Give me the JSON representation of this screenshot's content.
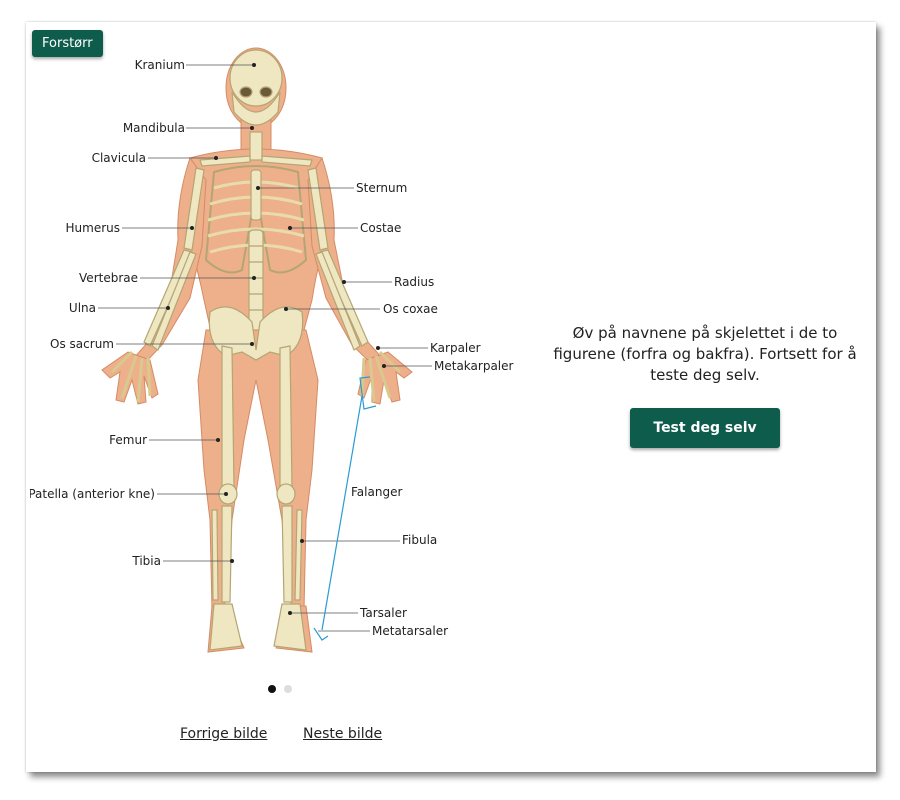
{
  "toolbar": {
    "enlarge_label": "Forstørr"
  },
  "labels": {
    "kranium": "Kranium",
    "mandibula": "Mandibula",
    "clavicula": "Clavicula",
    "humerus": "Humerus",
    "vertebrae": "Vertebrae",
    "ulna": "Ulna",
    "os_sacrum": "Os sacrum",
    "femur": "Femur",
    "patella": "Patella (anterior kne)",
    "tibia": "Tibia",
    "sternum": "Sternum",
    "costae": "Costae",
    "radius": "Radius",
    "os_coxae": "Os coxae",
    "karpaler": "Karpaler",
    "metakarpaler": "Metakarpaler",
    "falanger": "Falanger",
    "fibula": "Fibula",
    "tarsaler": "Tarsaler",
    "metatarsaler": "Metatarsaler"
  },
  "carousel": {
    "prev_label": "Forrige bilde",
    "next_label": "Neste bilde"
  },
  "side": {
    "text": "Øv på navnene på skjelettet i de to figurene (forfra og bakfra). Fortsett for å teste deg selv.",
    "test_button": "Test deg selv"
  },
  "colors": {
    "accent": "#0e5c4c",
    "skin": "#eeb08a",
    "bone": "#efe6c2",
    "bracket": "#2a9bd1"
  }
}
